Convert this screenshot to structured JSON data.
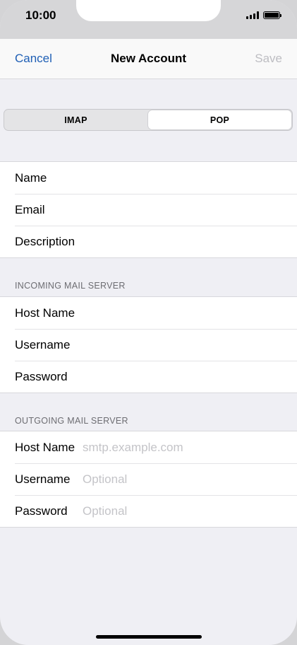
{
  "status_bar": {
    "time": "10:00"
  },
  "navbar": {
    "cancel_label": "Cancel",
    "title": "New Account",
    "save_label": "Save"
  },
  "segmented": {
    "options": [
      "IMAP",
      "POP"
    ],
    "selected": "POP"
  },
  "account_fields": [
    {
      "label": "Name",
      "value": "",
      "placeholder": ""
    },
    {
      "label": "Email",
      "value": "",
      "placeholder": ""
    },
    {
      "label": "Description",
      "value": "",
      "placeholder": ""
    }
  ],
  "incoming": {
    "header": "INCOMING MAIL SERVER",
    "fields": [
      {
        "label": "Host Name",
        "value": "",
        "placeholder": ""
      },
      {
        "label": "Username",
        "value": "",
        "placeholder": ""
      },
      {
        "label": "Password",
        "value": "",
        "placeholder": ""
      }
    ]
  },
  "outgoing": {
    "header": "OUTGOING MAIL SERVER",
    "fields": [
      {
        "label": "Host Name",
        "value": "",
        "placeholder": "smtp.example.com"
      },
      {
        "label": "Username",
        "value": "",
        "placeholder": "Optional"
      },
      {
        "label": "Password",
        "value": "",
        "placeholder": "Optional"
      }
    ]
  },
  "colors": {
    "accent": "#1f5fb5",
    "disabled": "#bdbdc2",
    "background": "#efeff4"
  }
}
